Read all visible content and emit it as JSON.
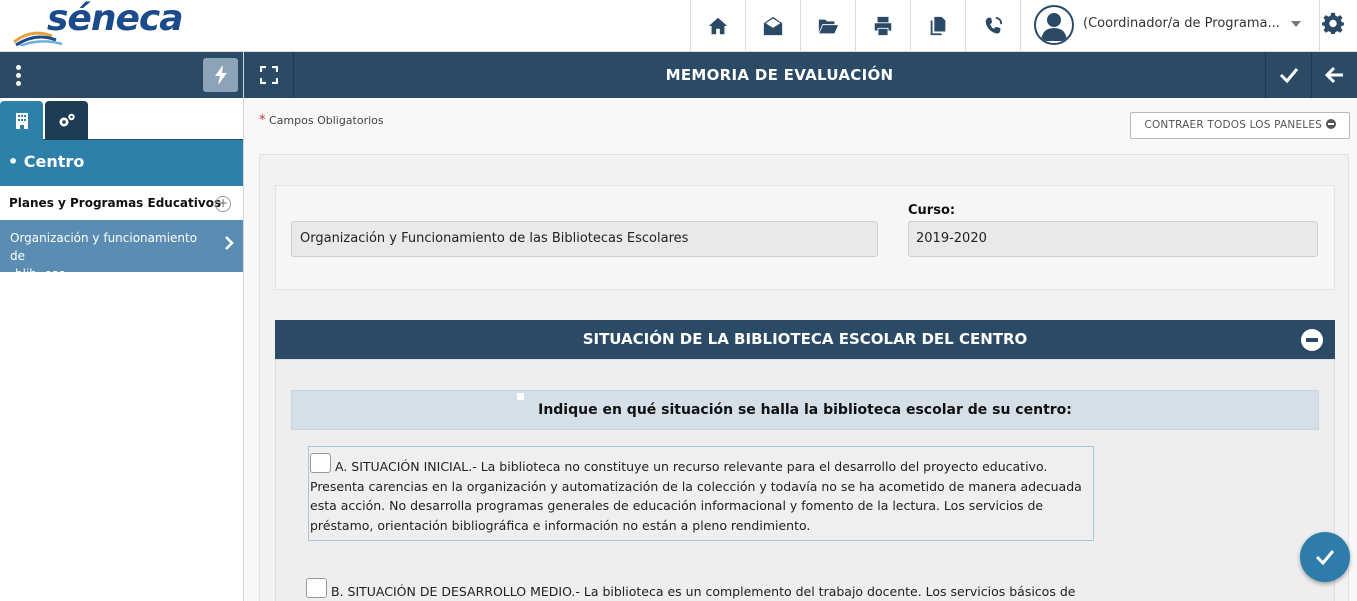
{
  "header": {
    "logo_text": "séneca",
    "user_label": "(Coordinador/a de Programa...",
    "icons": [
      "home-icon",
      "envelope-open-icon",
      "folder-open-icon",
      "print-icon",
      "copy-icon",
      "phone-volume-icon",
      "user-avatar-icon",
      "gear-icon"
    ]
  },
  "sidebar": {
    "section_title": "• Centro",
    "item_planes": "Planes y Programas Educativos",
    "item_planes_plus": "+",
    "item_org_line1": "Organización y funcionamiento de",
    "item_org_line2": "blib. esc."
  },
  "main_header": {
    "title": "MEMORIA DE EVALUACIÓN"
  },
  "form": {
    "required_star": "*",
    "required_note": "Campos Obligatorios",
    "collapse_all": "CONTRAER TODOS LOS PANELES",
    "program_value": "Organización y Funcionamiento de las Bibliotecas Escolares",
    "curso_label": "Curso:",
    "curso_value": "2019-2020"
  },
  "panel": {
    "title": "SITUACIÓN DE LA BIBLIOTECA ESCOLAR DEL CENTRO",
    "question": "Indique en qué situación se halla la biblioteca escolar de su centro:",
    "option_a": "A. SITUACIÓN INICIAL.- La biblioteca no constituye un recurso relevante para el desarrollo del proyecto educativo. Presenta carencias en la organización y automatización de la colección y todavía no se ha acometido de manera adecuada esta acción. No desarrolla programas generales de educación informacional y fomento de la lectura. Los servicios de préstamo, orientación bibliográfica e información no están a pleno rendimiento.",
    "option_b": "B. SITUACIÓN DE DESARROLLO MEDIO.- La biblioteca es un complemento del trabajo docente. Los servicios básicos de"
  },
  "colors": {
    "nav_dark": "#2b4a66",
    "accent_blue": "#2d80aa",
    "sidebar_selected": "#5b8db3"
  }
}
